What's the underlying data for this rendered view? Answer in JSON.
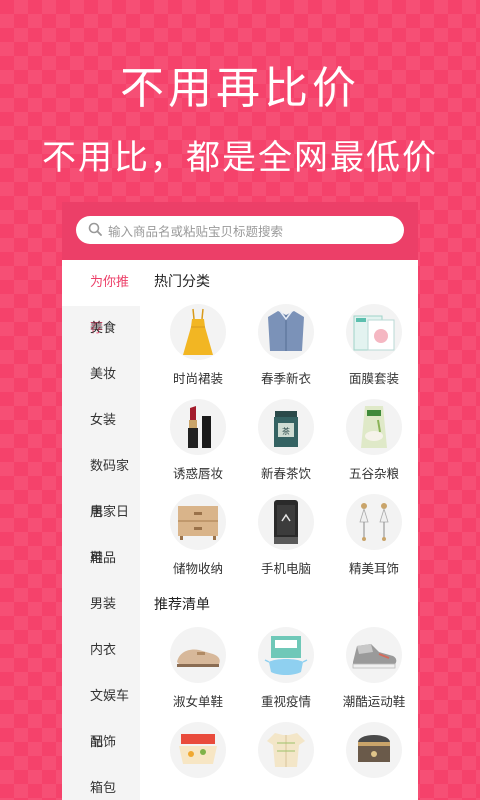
{
  "hero": {
    "headline": "不用再比价",
    "subline": "不用比，都是全网最低价"
  },
  "search": {
    "placeholder": "输入商品名或粘贴宝贝标题搜索"
  },
  "sidebar": {
    "items": [
      {
        "label": "为你推荐",
        "active": true
      },
      {
        "label": "美食"
      },
      {
        "label": "美妆"
      },
      {
        "label": "女装"
      },
      {
        "label": "数码家电"
      },
      {
        "label": "居家日用"
      },
      {
        "label": "鞋品"
      },
      {
        "label": "男装"
      },
      {
        "label": "内衣"
      },
      {
        "label": "文娱车品"
      },
      {
        "label": "配饰"
      },
      {
        "label": "箱包"
      }
    ]
  },
  "sections": {
    "hot": {
      "title": "热门分类",
      "items": [
        {
          "label": "时尚裙装",
          "icon": "dress-icon"
        },
        {
          "label": "春季新衣",
          "icon": "shirt-icon"
        },
        {
          "label": "面膜套装",
          "icon": "mask-box-icon"
        },
        {
          "label": "诱惑唇妆",
          "icon": "lipstick-icon"
        },
        {
          "label": "新春茶饮",
          "icon": "tea-can-icon"
        },
        {
          "label": "五谷杂粮",
          "icon": "rice-bag-icon"
        },
        {
          "label": "储物收纳",
          "icon": "drawer-icon"
        },
        {
          "label": "手机电脑",
          "icon": "phone-icon"
        },
        {
          "label": "精美耳饰",
          "icon": "earrings-icon"
        }
      ]
    },
    "recommend": {
      "title": "推荐清单",
      "items": [
        {
          "label": "淑女单鞋",
          "icon": "loafer-icon"
        },
        {
          "label": "重视疫情",
          "icon": "face-mask-icon"
        },
        {
          "label": "潮酷运动鞋",
          "icon": "sneaker-icon"
        },
        {
          "label": "",
          "icon": "noodle-bowl-icon"
        },
        {
          "label": "",
          "icon": "pajamas-icon"
        },
        {
          "label": "",
          "icon": "rice-cooker-icon"
        }
      ]
    }
  },
  "colors": {
    "brand": "#ec3f68",
    "background": "#f5426b"
  }
}
